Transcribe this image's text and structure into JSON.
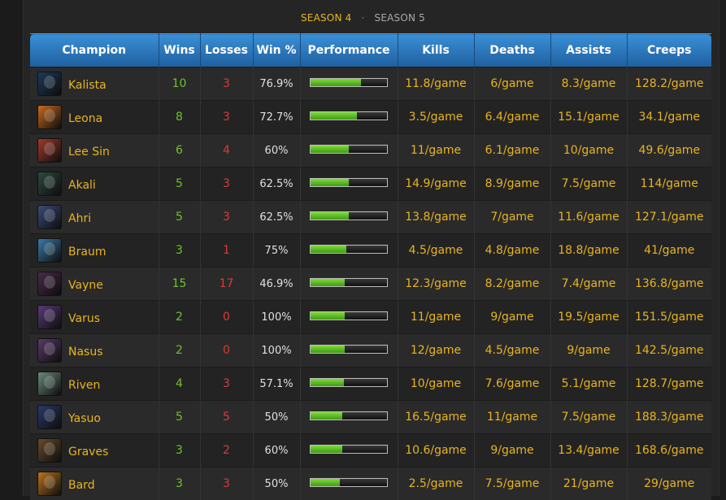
{
  "seasons": {
    "active": "SEASON 4",
    "separator": "·",
    "inactive": "SEASON 5"
  },
  "columns": [
    "Champion",
    "Wins",
    "Losses",
    "Win %",
    "Performance",
    "Kills",
    "Deaths",
    "Assists",
    "Creeps"
  ],
  "colors": {
    "accent": "#e8b422",
    "wins": "#6dc32c",
    "losses": "#d83a3a",
    "header": "#2a76bd",
    "bar_fill": "#5cbf20"
  },
  "rows": [
    {
      "champion": "Kalista",
      "icon": "kalista-portrait-icon",
      "color": "#1c3a5a",
      "wins": "10",
      "losses": "3",
      "win_pct": "76.9%",
      "performance": 0.66,
      "kills": "11.8/game",
      "deaths": "6/game",
      "assists": "8.3/game",
      "creeps": "128.2/game"
    },
    {
      "champion": "Leona",
      "icon": "leona-portrait-icon",
      "color": "#c96a1e",
      "wins": "8",
      "losses": "3",
      "win_pct": "72.7%",
      "performance": 0.61,
      "kills": "3.5/game",
      "deaths": "6.4/game",
      "assists": "15.1/game",
      "creeps": "34.1/game"
    },
    {
      "champion": "Lee Sin",
      "icon": "lee-sin-portrait-icon",
      "color": "#a13a2a",
      "wins": "6",
      "losses": "4",
      "win_pct": "60%",
      "performance": 0.5,
      "kills": "11/game",
      "deaths": "6.1/game",
      "assists": "10/game",
      "creeps": "49.6/game"
    },
    {
      "champion": "Akali",
      "icon": "akali-portrait-icon",
      "color": "#2d4a3e",
      "wins": "5",
      "losses": "3",
      "win_pct": "62.5%",
      "performance": 0.5,
      "kills": "14.9/game",
      "deaths": "8.9/game",
      "assists": "7.5/game",
      "creeps": "114/game"
    },
    {
      "champion": "Ahri",
      "icon": "ahri-portrait-icon",
      "color": "#3a4c7a",
      "wins": "5",
      "losses": "3",
      "win_pct": "62.5%",
      "performance": 0.5,
      "kills": "13.8/game",
      "deaths": "7/game",
      "assists": "11.6/game",
      "creeps": "127.1/game"
    },
    {
      "champion": "Braum",
      "icon": "braum-portrait-icon",
      "color": "#3a7aa6",
      "wins": "3",
      "losses": "1",
      "win_pct": "75%",
      "performance": 0.47,
      "kills": "4.5/game",
      "deaths": "4.8/game",
      "assists": "18.8/game",
      "creeps": "41/game"
    },
    {
      "champion": "Vayne",
      "icon": "vayne-portrait-icon",
      "color": "#4a2a4a",
      "wins": "15",
      "losses": "17",
      "win_pct": "46.9%",
      "performance": 0.45,
      "kills": "12.3/game",
      "deaths": "8.2/game",
      "assists": "7.4/game",
      "creeps": "136.8/game"
    },
    {
      "champion": "Varus",
      "icon": "varus-portrait-icon",
      "color": "#5a3a7a",
      "wins": "2",
      "losses": "0",
      "win_pct": "100%",
      "performance": 0.45,
      "kills": "11/game",
      "deaths": "9/game",
      "assists": "19.5/game",
      "creeps": "151.5/game"
    },
    {
      "champion": "Nasus",
      "icon": "nasus-portrait-icon",
      "color": "#5a3a6a",
      "wins": "2",
      "losses": "0",
      "win_pct": "100%",
      "performance": 0.45,
      "kills": "12/game",
      "deaths": "4.5/game",
      "assists": "9/game",
      "creeps": "142.5/game"
    },
    {
      "champion": "Riven",
      "icon": "riven-portrait-icon",
      "color": "#6a8a7a",
      "wins": "4",
      "losses": "3",
      "win_pct": "57.1%",
      "performance": 0.44,
      "kills": "10/game",
      "deaths": "7.6/game",
      "assists": "5.1/game",
      "creeps": "128.7/game"
    },
    {
      "champion": "Yasuo",
      "icon": "yasuo-portrait-icon",
      "color": "#2a3a6a",
      "wins": "5",
      "losses": "5",
      "win_pct": "50%",
      "performance": 0.42,
      "kills": "16.5/game",
      "deaths": "11/game",
      "assists": "7.5/game",
      "creeps": "188.3/game"
    },
    {
      "champion": "Graves",
      "icon": "graves-portrait-icon",
      "color": "#6a4a2a",
      "wins": "3",
      "losses": "2",
      "win_pct": "60%",
      "performance": 0.41,
      "kills": "10.6/game",
      "deaths": "9/game",
      "assists": "13.4/game",
      "creeps": "168.6/game"
    },
    {
      "champion": "Bard",
      "icon": "bard-portrait-icon",
      "color": "#b8741e",
      "wins": "3",
      "losses": "3",
      "win_pct": "50%",
      "performance": 0.38,
      "kills": "2.5/game",
      "deaths": "7.5/game",
      "assists": "21/game",
      "creeps": "29/game"
    }
  ]
}
